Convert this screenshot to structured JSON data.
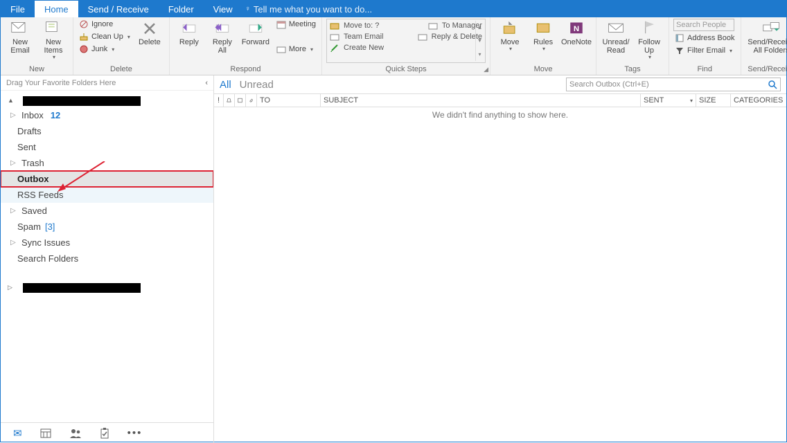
{
  "tabs": {
    "file": "File",
    "home": "Home",
    "sendrecv": "Send / Receive",
    "folder": "Folder",
    "view": "View",
    "tellme": "Tell me what you want to do..."
  },
  "ribbon": {
    "new": {
      "email": "New\nEmail",
      "items": "New\nItems",
      "label": "New"
    },
    "delete": {
      "ignore": "Ignore",
      "cleanup": "Clean Up",
      "junk": "Junk",
      "delete": "Delete",
      "label": "Delete"
    },
    "respond": {
      "reply": "Reply",
      "replyall": "Reply\nAll",
      "forward": "Forward",
      "meeting": "Meeting",
      "more": "More",
      "label": "Respond"
    },
    "quicksteps": {
      "moveto": "Move to: ?",
      "team": "Team Email",
      "create": "Create New",
      "tomgr": "To Manager",
      "replydel": "Reply & Delete",
      "label": "Quick Steps"
    },
    "move": {
      "move": "Move",
      "rules": "Rules",
      "onenote": "OneNote",
      "label": "Move"
    },
    "tags": {
      "unread": "Unread/\nRead",
      "follow": "Follow\nUp",
      "label": "Tags"
    },
    "find": {
      "searchph": "Search People",
      "addr": "Address Book",
      "filter": "Filter Email",
      "label": "Find"
    },
    "sendrecv": {
      "btn": "Send/Receive\nAll Folders",
      "label": "Send/Receive"
    }
  },
  "sidebar": {
    "favhint": "Drag Your Favorite Folders Here",
    "folders": {
      "inbox": "Inbox",
      "inboxcount": "12",
      "drafts": "Drafts",
      "sent": "Sent",
      "trash": "Trash",
      "outbox": "Outbox",
      "rss": "RSS Feeds",
      "saved": "Saved",
      "spam": "Spam",
      "spamcount": "[3]",
      "sync": "Sync Issues",
      "search": "Search Folders"
    }
  },
  "main": {
    "all": "All",
    "unread": "Unread",
    "searchph": "Search Outbox (Ctrl+E)",
    "cols": {
      "to": "TO",
      "subject": "SUBJECT",
      "sent": "SENT",
      "size": "SIZE",
      "cat": "CATEGORIES"
    },
    "empty": "We didn't find anything to show here."
  }
}
